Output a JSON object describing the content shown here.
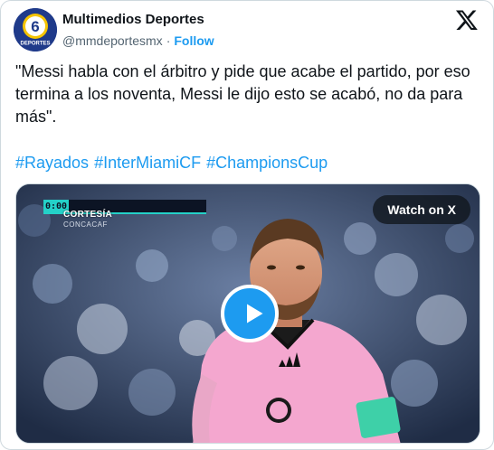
{
  "account": {
    "name": "Multimedios Deportes",
    "handle": "@mmdeportesmx",
    "separator": "·",
    "follow_label": "Follow",
    "avatar_text": "DEPORTES",
    "avatar_number": "6"
  },
  "tweet": {
    "text": "\"Messi habla con el árbitro y pide que acabe el partido, por eso termina a los noventa, Messi le dijo esto se acabó, no da para más\".",
    "hashtags": [
      "#Rayados",
      "#InterMiamiCF",
      "#ChampionsCup"
    ]
  },
  "media": {
    "watch_label": "Watch on X",
    "score_time": "0:00",
    "caption_line1": "CORTESÍA",
    "caption_line2": "CONCACAF"
  },
  "colors": {
    "accent": "#1d9bf0",
    "text": "#0f1419",
    "secondary": "#536471",
    "jersey": "#f4a7cf"
  },
  "icons": {
    "brand": "x-logo-icon",
    "play": "play-icon"
  }
}
